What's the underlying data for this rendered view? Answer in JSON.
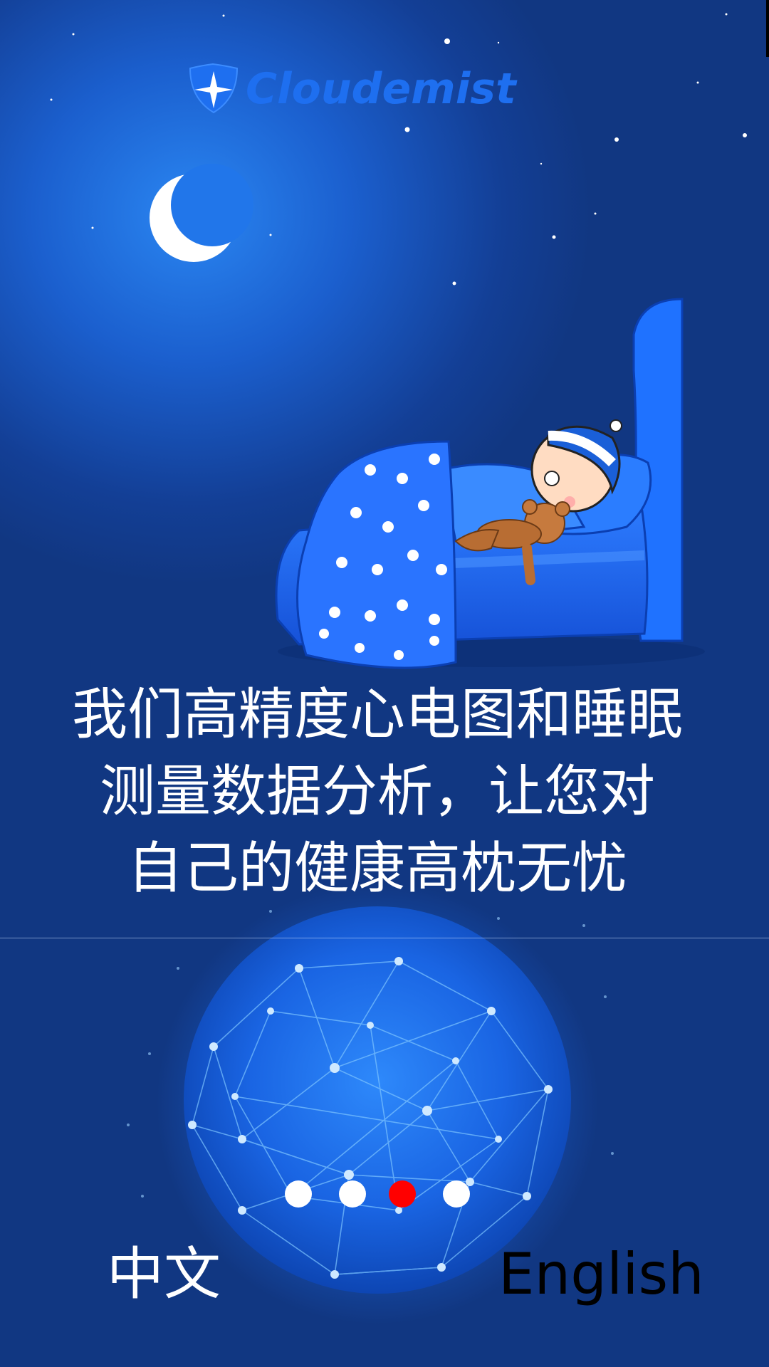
{
  "app": {
    "brand_name": "Cloudemist"
  },
  "headline": {
    "lines": [
      "我们高精度心电图和睡眠",
      "测量数据分析，让您对",
      "自己的健康高枕无忧"
    ]
  },
  "pagination": {
    "total": 4,
    "active_index": 2,
    "active_color": "#ff0000",
    "inactive_color": "#ffffff"
  },
  "language_options": {
    "chinese_label": "中文",
    "english_label": "English"
  },
  "colors": {
    "background": "#113782",
    "glow": "#2a86f2",
    "logo_blue": "#1e6ff0"
  },
  "icons": {
    "logo": "shield-star-icon",
    "moon": "crescent-moon-icon",
    "illustration": "sleeping-child-bed-illustration",
    "globe": "network-globe-illustration"
  }
}
